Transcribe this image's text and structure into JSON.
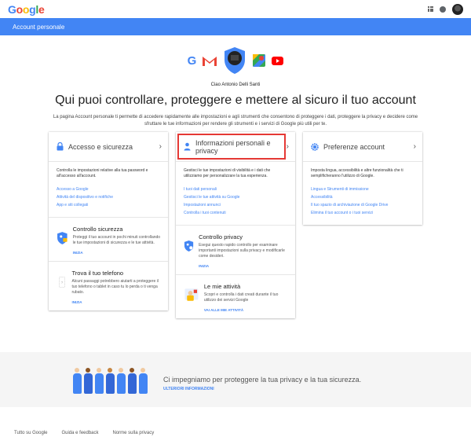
{
  "header": {
    "logo_letters": [
      "G",
      "o",
      "o",
      "g",
      "l",
      "e"
    ],
    "apps_icon": "apps-grid-icon",
    "notifications_icon": "bell-icon"
  },
  "bluebar": {
    "title": "Account personale"
  },
  "hero": {
    "greeting": "Ciao Antonio Delli Santi",
    "headline": "Qui puoi controllare, proteggere e mettere al sicuro il tuo account",
    "subtitle": "La pagina Account personale ti permette di accedere rapidamente alle impostazioni e agli strumenti che consentono di proteggere i dati, proteggere la privacy e decidere come sfruttare le tue informazioni per rendere gli strumenti e i servizi di Google più utili per te."
  },
  "cards": {
    "security": {
      "title": "Accesso e sicurezza",
      "desc": "Controlla le impostazioni relative alla tua password e all'accesso all'account.",
      "links": [
        "Accesso a Google",
        "Attività del dispositivo e notifiche",
        "App e siti collegati"
      ],
      "features": [
        {
          "title": "Controllo sicurezza",
          "text": "Proteggi il tuo account in pochi minuti controllando le tue impostazioni di sicurezza e le tue attività.",
          "button": "INIZIA"
        },
        {
          "title": "Trova il tuo telefono",
          "text": "Alcuni passaggi potrebbero aiutarti a proteggere il tuo telefono o tablet in caso tu lo perda o ti venga rubato.",
          "button": "INIZIA"
        }
      ]
    },
    "privacy": {
      "title": "Informazioni personali e privacy",
      "desc": "Gestisci le tue impostazioni di visibilità e i dati che utilizziamo per personalizzare la tua esperienza.",
      "links": [
        "I tuoi dati personali",
        "Gestisci le tue attività su Google",
        "Impostazioni annunci",
        "Controlla i tuoi contenuti"
      ],
      "features": [
        {
          "title": "Controllo privacy",
          "text": "Esegui questo rapido controllo per esaminare importanti impostazioni sulla privacy e modificarle come desideri.",
          "button": "INIZIA"
        },
        {
          "title": "Le mie attività",
          "text": "Scopri e controlla i dati creati durante il tuo utilizzo dei servizi Google",
          "button": "VAI ALLE MIE ATTIVITÀ"
        }
      ]
    },
    "prefs": {
      "title": "Preferenze account",
      "desc": "Imposta lingua, accessibilità e altre funzionalità che ti semplificheranno l'utilizzo di Google.",
      "links": [
        "Lingua e Strumenti di immissione",
        "Accessibilità",
        "Il tuo spazio di archiviazione di Google Drive",
        "Elimina il tuo account o i tuoi servizi"
      ]
    }
  },
  "banner": {
    "text": "Ci impegniamo per proteggere la tua privacy e la tua sicurezza.",
    "link": "ULTERIORI INFORMAZIONI"
  },
  "footer": {
    "links": [
      "Tutto su Google",
      "Guida e feedback",
      "Norme sulla privacy"
    ]
  },
  "colors": {
    "brand_blue": "#4285f4",
    "highlight_red": "#e53935",
    "banner_bg": "#f5f5f5"
  }
}
